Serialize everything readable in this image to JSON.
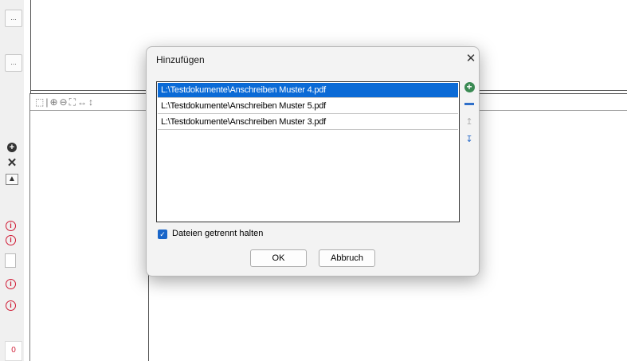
{
  "dialog": {
    "title": "Hinzufügen",
    "close_glyph": "✕",
    "files": [
      {
        "path": "L:\\Testdokumente\\Anschreiben Muster 4.pdf",
        "selected": true
      },
      {
        "path": "L:\\Testdokumente\\Anschreiben Muster 5.pdf",
        "selected": false
      },
      {
        "path": "L:\\Testdokumente\\Anschreiben Muster 3.pdf",
        "selected": false
      }
    ],
    "side_icons": [
      "add-icon",
      "remove-icon",
      "move-up-icon",
      "move-down-icon"
    ],
    "checkbox_label": "Dateien getrennt halten",
    "checkbox_checked": true,
    "ok_label": "OK",
    "cancel_label": "Abbruch"
  },
  "left_strip": {
    "button_1": "...",
    "button_2": "...",
    "warn_glyph": "i",
    "bottom_digit": "0"
  },
  "toolbar": {
    "icons": "⬚|⊕⊖⛶↔↕"
  },
  "colors": {
    "selection": "#0a6ad6",
    "add_green": "#3a8a53",
    "accent_blue": "#2f6fc9",
    "warning_red": "#d01a34"
  }
}
